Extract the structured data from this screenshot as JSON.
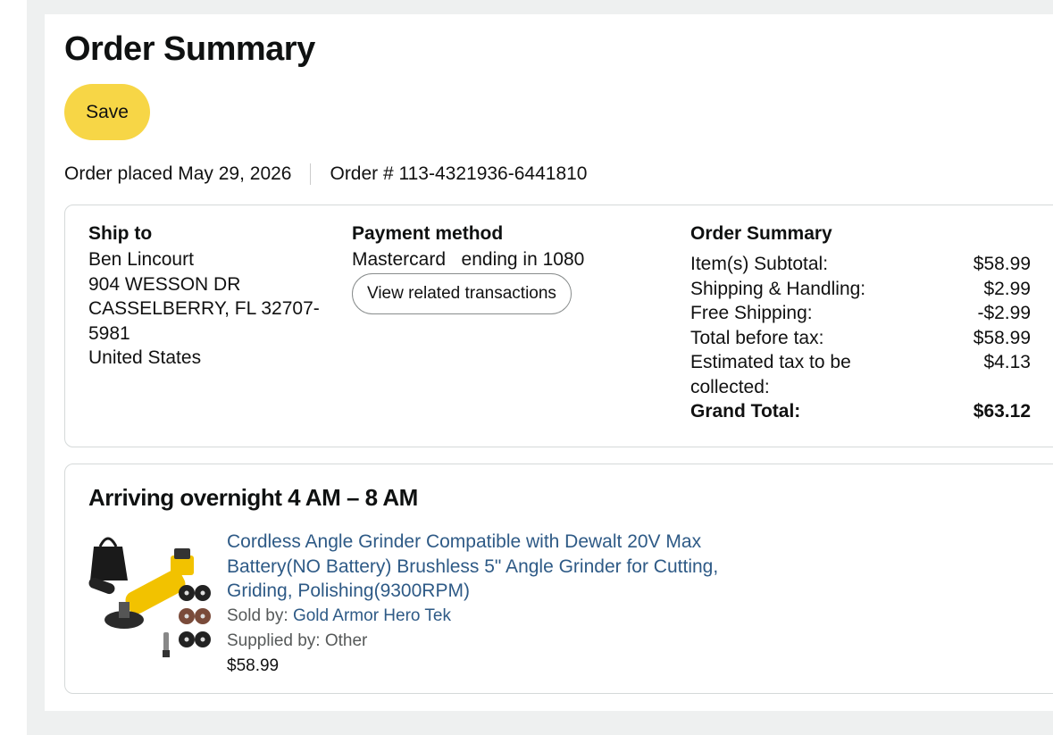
{
  "header": {
    "title": "Order Summary",
    "save_label": "Save",
    "order_placed": "Order placed May 29, 2026",
    "order_number": "Order # 113-4321936-6441810"
  },
  "ship_to": {
    "heading": "Ship to",
    "lines": [
      "Ben Lincourt",
      "904 WESSON DR",
      "CASSELBERRY, FL 32707-",
      "5981",
      "United States"
    ]
  },
  "payment": {
    "heading": "Payment method",
    "card": "Mastercard   ending in 1080",
    "view_transactions_label": "View related transactions"
  },
  "summary": {
    "heading": "Order Summary",
    "rows": [
      {
        "label": "Item(s) Subtotal:",
        "value": "$58.99"
      },
      {
        "label": "Shipping & Handling:",
        "value": "$2.99"
      },
      {
        "label": "Free Shipping:",
        "value": "-$2.99"
      },
      {
        "label": "Total before tax:",
        "value": "$58.99"
      },
      {
        "label": "Estimated tax to be collected:",
        "value": "$4.13"
      }
    ],
    "grand_total_label": "Grand Total:",
    "grand_total_value": "$63.12"
  },
  "shipment": {
    "arrival": "Arriving overnight 4 AM – 8 AM",
    "product": {
      "title": "Cordless Angle Grinder Compatible with Dewalt 20V Max Battery(NO Battery) Brushless 5\" Angle Grinder for Cutting, Griding, Polishing(9300RPM)",
      "sold_by_label": "Sold by: ",
      "seller": "Gold Armor Hero Tek",
      "supplied_by": "Supplied by: Other",
      "price": "$58.99",
      "image_icon": "angle-grinder-product-image"
    }
  },
  "colors": {
    "save_button": "#f7d646",
    "link": "#2e5a86",
    "border": "#d5d9d9",
    "outer_bg": "#eef0f0"
  }
}
